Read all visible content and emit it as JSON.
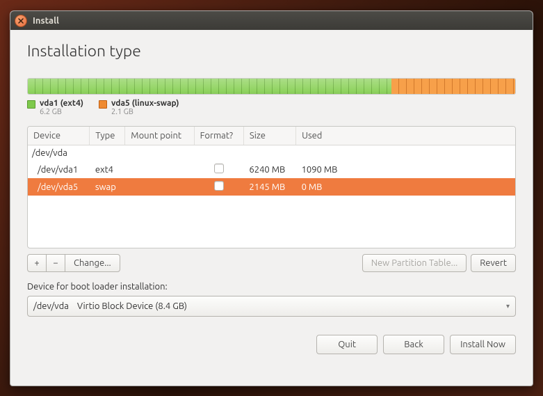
{
  "window": {
    "title": "Install"
  },
  "heading": "Installation type",
  "disk": {
    "segments": [
      {
        "key": "vda1",
        "color": "green",
        "percent": 74.6
      },
      {
        "key": "vda5",
        "color": "orange",
        "percent": 25.4
      }
    ],
    "legend": [
      {
        "color": "green",
        "name": "vda1 (ext4)",
        "size": "6.2 GB"
      },
      {
        "color": "orange",
        "name": "vda5 (linux-swap)",
        "size": "2.1 GB"
      }
    ]
  },
  "table": {
    "headers": {
      "device": "Device",
      "type": "Type",
      "mount": "Mount point",
      "format": "Format?",
      "size": "Size",
      "used": "Used"
    },
    "rows": [
      {
        "kind": "parent",
        "device": "/dev/vda",
        "type": "",
        "mount": "",
        "format": null,
        "size": "",
        "used": "",
        "selected": false
      },
      {
        "kind": "child",
        "device": "/dev/vda1",
        "type": "ext4",
        "mount": "",
        "format": false,
        "size": "6240 MB",
        "used": "1090 MB",
        "selected": false
      },
      {
        "kind": "child",
        "device": "/dev/vda5",
        "type": "swap",
        "mount": "",
        "format": false,
        "size": "2145 MB",
        "used": "0 MB",
        "selected": true
      }
    ]
  },
  "toolbar": {
    "add": "+",
    "remove": "−",
    "change": "Change...",
    "new_table": "New Partition Table...",
    "revert": "Revert"
  },
  "bootloader": {
    "label": "Device for boot loader installation:",
    "value": "/dev/vda    Virtio Block Device (8.4 GB)"
  },
  "footer": {
    "quit": "Quit",
    "back": "Back",
    "install": "Install Now"
  }
}
